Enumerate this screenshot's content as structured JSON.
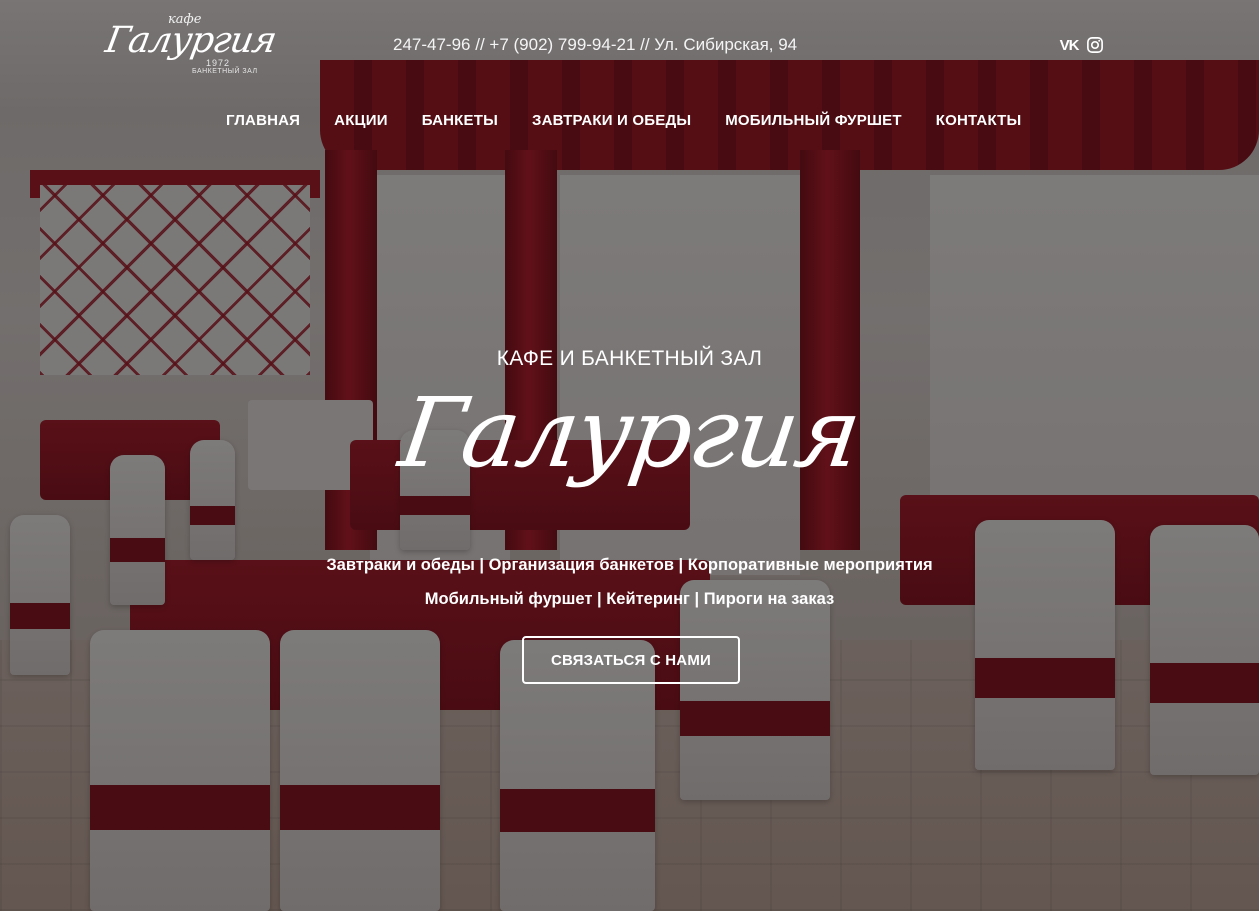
{
  "logo": {
    "small": "кафе",
    "main": "Галургия",
    "year": "1972",
    "sub": "БАНКЕТНЫЙ ЗАЛ"
  },
  "header": {
    "contacts": "247-47-96 // +7 (902) 799-94-21 // Ул. Сибирская, 94",
    "social": [
      {
        "icon": "vk-icon",
        "label": "VK"
      },
      {
        "icon": "instagram-icon"
      }
    ]
  },
  "nav": {
    "items": [
      {
        "label": "ГЛАВНАЯ"
      },
      {
        "label": "АКЦИИ"
      },
      {
        "label": "БАНКЕТЫ"
      },
      {
        "label": "ЗАВТРАКИ И ОБЕДЫ"
      },
      {
        "label": "МОБИЛЬНЫЙ ФУРШЕТ"
      },
      {
        "label": "КОНТАКТЫ"
      }
    ]
  },
  "hero": {
    "kicker": "КАФЕ И БАНКЕТНЫЙ ЗАЛ",
    "title": "Галургия",
    "line1": "Завтраки и обеды | Организация банкетов | Корпоративные мероприятия",
    "line2": "Мобильный фуршет | Кейтеринг | Пироги на заказ",
    "cta": "СВЯЗАТЬСЯ С НАМИ"
  },
  "colors": {
    "accent_red": "#a4101e",
    "overlay": "rgba(18,12,12,.55)",
    "text": "#ffffff"
  }
}
